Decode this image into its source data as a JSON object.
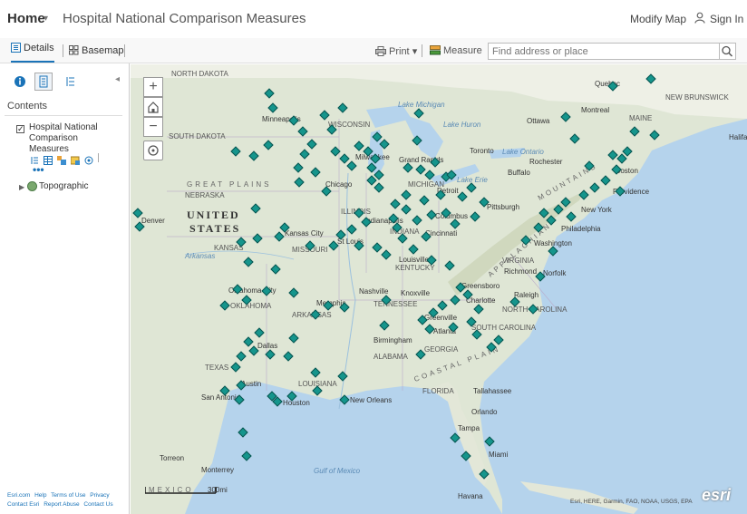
{
  "header": {
    "home_label": "Home",
    "home_caret": "▾",
    "title": "Hospital National Comparison Measures",
    "modify_map": "Modify Map",
    "sign_in": "Sign In"
  },
  "toolbar": {
    "details_label": "Details",
    "basemap_label": "Basemap",
    "print_label": "Print",
    "print_caret": "▾",
    "measure_label": "Measure",
    "search_placeholder": "Find address or place"
  },
  "panel": {
    "collapse_glyph": "◂",
    "contents_label": "Contents",
    "check_glyph": "✓",
    "layer_name": "Hospital National Comparison Measures",
    "more_glyph": "•••",
    "topo_caret": "▶",
    "topo_label": "Topographic",
    "footer_links": [
      "Esri.com",
      "Help",
      "Terms of Use",
      "Privacy",
      "Contact Esri",
      "Report Abuse",
      "Contact Us"
    ]
  },
  "map": {
    "zoom_in": "+",
    "zoom_out": "−",
    "scale_label": "300mi",
    "attribution": "Esri, HERE, Garmin, FAO, NOAA, USGS, EPA",
    "esri_logo": "esri",
    "labels": {
      "north_dakota": "NORTH DAKOTA",
      "south_dakota": "SOUTH DAKOTA",
      "nebraska": "NEBRASKA",
      "kansas": "KANSAS",
      "oklahoma": "OKLAHOMA",
      "texas": "TEXAS",
      "missouri": "MISSOURI",
      "arkansas": "ARKANSAS",
      "louisiana": "LOUISIANA",
      "illinois": "ILLINOIS",
      "indiana": "INDIANA",
      "kentucky": "KENTUCKY",
      "tennessee": "TENNESSEE",
      "alabama": "ALABAMA",
      "georgia": "GEORGIA",
      "florida": "FLORIDA",
      "south_carolina": "SOUTH CAROLINA",
      "north_carolina": "NORTH CAROLINA",
      "virginia": "VIRGINIA",
      "michigan": "MICHIGAN",
      "wisconsin": "WISCONSIN",
      "maine": "MAINE",
      "new_brunswick": "NEW BRUNSWICK",
      "united": "UNITED",
      "states": "STATES",
      "great_plains": "GREAT PLAINS",
      "appalachian": "APPALACHIAN",
      "mountains": "MOUNTAINS",
      "coastal_plain": "COASTAL PLAIN",
      "mexico": "MEXICO",
      "lake_michigan": "Lake Michigan",
      "lake_huron": "Lake Huron",
      "lake_erie": "Lake Erie",
      "lake_ontario": "Lake Ontario",
      "gulf_mexico": "Gulf of Mexico",
      "arkansas_river": "Arkansas",
      "minneapolis": "Minneapolis",
      "chicago": "Chicago",
      "milwaukee": "Milwaukee",
      "grand_rapids": "Grand Rapids",
      "detroit": "Detroit",
      "toronto": "Toronto",
      "ottawa": "Ottawa",
      "montreal": "Montreal",
      "quebec": "Quebec",
      "rochester": "Rochester",
      "buffalo": "Buffalo",
      "boston": "Boston",
      "providence": "Providence",
      "new_york": "New York",
      "philadelphia": "Philadelphia",
      "pittsburgh": "Pittsburgh",
      "columbus": "Columbus",
      "indianapolis": "Indianapolis",
      "cincinnati": "Cincinnati",
      "louisville": "Louisville",
      "st_louis": "St Louis",
      "kansas_city": "Kansas City",
      "denver": "Denver",
      "washington": "Washington",
      "richmond": "Richmond",
      "norfolk": "Norfolk",
      "raleigh": "Raleigh",
      "greensboro": "Greensboro",
      "charlotte": "Charlotte",
      "greenville": "Greenville",
      "atlanta": "Atlanta",
      "nashville": "Nashville",
      "knoxville": "Knoxville",
      "memphis": "Memphis",
      "birmingham": "Birmingham",
      "dallas": "Dallas",
      "austin": "Austin",
      "san_antonio": "San Antonio",
      "houston": "Houston",
      "new_orleans": "New Orleans",
      "tallahassee": "Tallahassee",
      "orlando": "Orlando",
      "tampa": "Tampa",
      "miami": "Miami",
      "havana": "Havana",
      "monterrey": "Monterrey",
      "torreon": "Torreon",
      "halifax": "Halifa",
      "oklahoma_city": "Oklahoma City"
    }
  },
  "colors": {
    "marker": "#15958c",
    "water": "#b5d3ec",
    "land": "#e3e7d8",
    "accent": "#1a73b8"
  },
  "icons": {
    "details": "details-list-icon",
    "basemap": "basemap-grid-icon",
    "print": "printer-icon",
    "measure": "ruler-icon",
    "search": "magnifier-icon",
    "signin": "person-icon",
    "home_extent": "home-icon",
    "locate": "locate-crosshair-icon"
  }
}
